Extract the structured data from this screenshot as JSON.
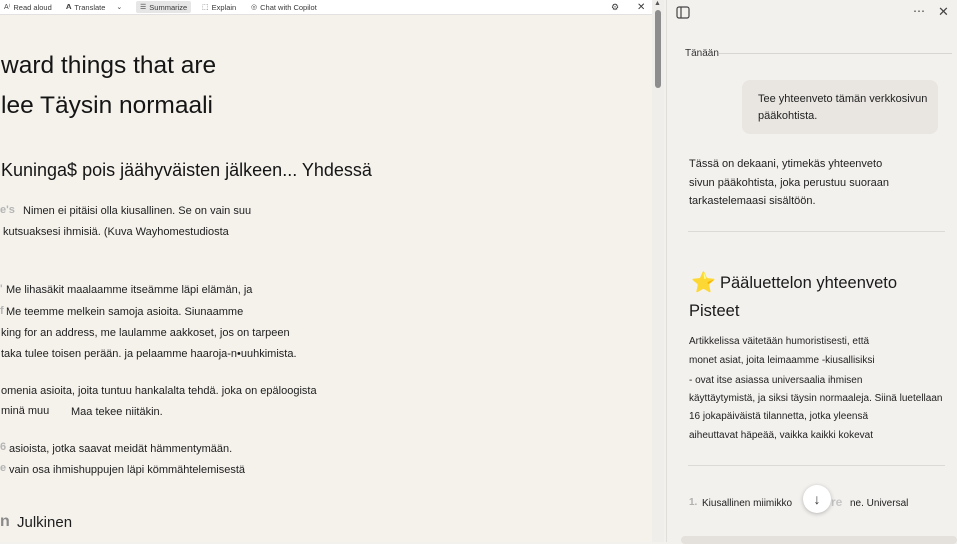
{
  "toolbar": {
    "read_aloud": "Read aloud",
    "translate": "Translate",
    "summarize": "Summarize",
    "explain": "Explain",
    "chat": "Chat with Copilot"
  },
  "article": {
    "headline_line1": "ward things that are",
    "headline_line2": "lee Täysin normaali",
    "subheading": "Kuninga$ pois jäähyväisten jälkeen... Yhdessä",
    "ghost_1": "e's",
    "p1_line1": "Nimen ei pitäisi olla kiusallinen. Se on vain suu",
    "p1_line2": "kutsuaksesi ihmisiä. (Kuva Wayhomestudiosta",
    "ghost_2": "'",
    "p2_line1": "Me lihasäkit maalaamme itseämme läpi elämän, ja",
    "ghost_3": "f",
    "p2_line2": "Me teemme melkein samoja asioita. Siunaamme",
    "p2_line3": "king for an address, me laulamme aakkoset, jos on tarpeen",
    "p2_line4": "taka tulee toisen perään. ja pelaamme haaroja-n•uuhkimista.",
    "p3_line1": "omenia asioita, joita tuntuu hankalalta tehdä. joka on epäloogista",
    "p3_line2a": "minä muu",
    "p3_line2b": "Maa tekee niitäkin.",
    "ghost_4": "6",
    "p4_line1": "asioista, jotka saavat meidät hämmentymään.",
    "ghost_5": "e",
    "p4_line2": "vain osa ihmishuppujen läpi kömmähtelemisestä",
    "ghost_6": "n",
    "section_title": "Julkinen"
  },
  "copilot": {
    "today": "Tänään",
    "user_message_line1": "Tee yhteenveto tämän verkkosivun",
    "user_message_line2": "pääkohtista.",
    "reply_line1": "Tässä on dekaani, ytimekäs yhteenveto",
    "reply_line2": "sivun pääkohtista, joka perustuu suoraan",
    "reply_line3": "tarkastelemaasi sisältöön.",
    "summary_heading": "Pääluettelon yhteenveto",
    "points_heading": "Pisteet",
    "body_line1": "Artikkelissa väitetään humoristisesti, että",
    "body_line2": "monet asiat, joita leimaamme -kiusallisiksi",
    "body_line3": "- ovat itse asiassa universaalia ihmisen",
    "body_line4": "käyttäytymistä, ja siksi täysin normaaleja. Siinä luetellaan",
    "body_line5": "16 jokapäiväistä tilannetta, jotka yleensä",
    "body_line6": "aiheuttavat häpeää, vaikka kaikki kokevat",
    "list_number": "1.",
    "list_item_a": "Kiusallinen miimikko",
    "list_item_ghost": "re",
    "list_item_b": "ne. Universal",
    "icons": [
      "sidebar-icon",
      "more-icon",
      "close-icon",
      "star-icon",
      "arrow-down-icon"
    ]
  }
}
